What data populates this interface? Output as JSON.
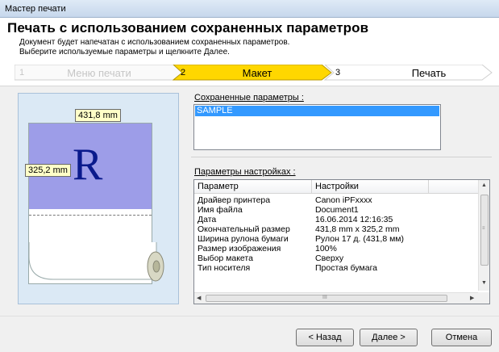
{
  "window": {
    "title": "Мастер печати"
  },
  "header": {
    "title": "Печать с использованием сохраненных параметров",
    "description_line1": "Документ будет напечатан с использованием сохраненных параметров.",
    "description_line2": "Выберите используемые параметры и щелкните Далее."
  },
  "steps": [
    {
      "number": "1",
      "label": "Меню печати",
      "state": "disabled"
    },
    {
      "number": "2",
      "label": "Макет",
      "state": "active"
    },
    {
      "number": "3",
      "label": "Печать",
      "state": "upcoming"
    }
  ],
  "preview": {
    "width_label": "431,8 mm",
    "height_label": "325,2 mm",
    "glyph": "R"
  },
  "saved_params": {
    "label": "Сохраненные параметры :",
    "items": [
      "SAMPLE"
    ],
    "selected": "SAMPLE"
  },
  "settings": {
    "label": "Параметры настройках :",
    "columns": [
      "Параметр",
      "Настройки"
    ],
    "rows": [
      {
        "param": "Драйвер принтера",
        "value": "Canon iPFxxxx"
      },
      {
        "param": "Имя файла",
        "value": "Document1"
      },
      {
        "param": "Дата",
        "value": "16.06.2014 12:16:35"
      },
      {
        "param": "Окончательный размер",
        "value": "431,8 mm x 325,2 mm"
      },
      {
        "param": "Ширина рулона бумаги",
        "value": "Рулон 17 д. (431,8 мм)"
      },
      {
        "param": "Размер изображения",
        "value": "100%"
      },
      {
        "param": "Выбор макета",
        "value": "Сверху"
      },
      {
        "param": "Тип носителя",
        "value": "Простая бумага"
      }
    ],
    "hscroll_glyph": "III"
  },
  "buttons": {
    "back": "< Назад",
    "next": "Далее >",
    "cancel": "Отмена"
  },
  "colors": {
    "active_step": "#ffd700",
    "selection": "#3399ff",
    "print_area": "#9d9de8",
    "preview_bg": "#dbe9f5",
    "dimension_label_bg": "#ffffc8"
  }
}
